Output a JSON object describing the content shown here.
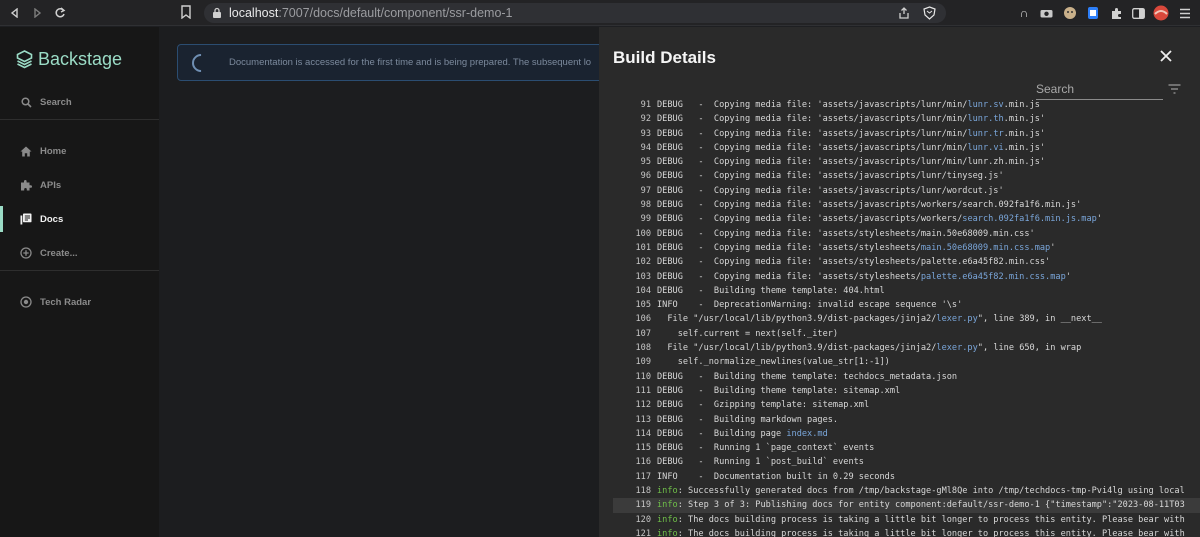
{
  "browser": {
    "url_host": "localhost",
    "url_path": ":7007/docs/default/component/ssr-demo-1"
  },
  "sidebar": {
    "logo": "Backstage",
    "items": [
      {
        "label": "Search",
        "icon": "search-icon"
      },
      {
        "label": "Home",
        "icon": "home-icon"
      },
      {
        "label": "APIs",
        "icon": "puzzle-icon"
      },
      {
        "label": "Docs",
        "icon": "library-icon",
        "active": true
      },
      {
        "label": "Create...",
        "icon": "add-circle-icon"
      },
      {
        "label": "Tech Radar",
        "icon": "radar-icon"
      }
    ],
    "accent": "#9BDCC6"
  },
  "main": {
    "alert": "Documentation is accessed for the first time and is being prepared. The subsequent lo"
  },
  "drawer": {
    "title": "Build Details",
    "search_placeholder": "Search",
    "log": [
      {
        "n": "91",
        "lv": "DEBUG",
        "pre": "   -  Copying media file: 'assets/javascripts/lunr/min/",
        "link": "lunr.sv",
        "post": ".min.js"
      },
      {
        "n": "92",
        "lv": "DEBUG",
        "pre": "   -  Copying media file: 'assets/javascripts/lunr/min/",
        "link": "lunr.th",
        "post": ".min.js'"
      },
      {
        "n": "93",
        "lv": "DEBUG",
        "pre": "   -  Copying media file: 'assets/javascripts/lunr/min/",
        "link": "lunr.tr",
        "post": ".min.js'"
      },
      {
        "n": "94",
        "lv": "DEBUG",
        "pre": "   -  Copying media file: 'assets/javascripts/lunr/min/",
        "link": "lunr.vi",
        "post": ".min.js'"
      },
      {
        "n": "95",
        "lv": "DEBUG",
        "pre": "   -  Copying media file: 'assets/javascripts/lunr/min/lunr.zh.min.js'",
        "link": "",
        "post": ""
      },
      {
        "n": "96",
        "lv": "DEBUG",
        "pre": "   -  Copying media file: 'assets/javascripts/lunr/tinyseg.js'",
        "link": "",
        "post": ""
      },
      {
        "n": "97",
        "lv": "DEBUG",
        "pre": "   -  Copying media file: 'assets/javascripts/lunr/wordcut.js'",
        "link": "",
        "post": ""
      },
      {
        "n": "98",
        "lv": "DEBUG",
        "pre": "   -  Copying media file: 'assets/javascripts/workers/search.092fa1f6.min.js'",
        "link": "",
        "post": ""
      },
      {
        "n": "99",
        "lv": "DEBUG",
        "pre": "   -  Copying media file: 'assets/javascripts/workers/",
        "link": "search.092fa1f6.min.js.map",
        "post": "'"
      },
      {
        "n": "100",
        "lv": "DEBUG",
        "pre": "   -  Copying media file: 'assets/stylesheets/main.50e68009.min.css'",
        "link": "",
        "post": ""
      },
      {
        "n": "101",
        "lv": "DEBUG",
        "pre": "   -  Copying media file: 'assets/stylesheets/",
        "link": "main.50e68009.min.css.map",
        "post": "'"
      },
      {
        "n": "102",
        "lv": "DEBUG",
        "pre": "   -  Copying media file: 'assets/stylesheets/palette.e6a45f82.min.css'",
        "link": "",
        "post": ""
      },
      {
        "n": "103",
        "lv": "DEBUG",
        "pre": "   -  Copying media file: 'assets/stylesheets/",
        "link": "palette.e6a45f82.min.css.map",
        "post": "'"
      },
      {
        "n": "104",
        "lv": "DEBUG",
        "pre": "   -  Building theme template: 404.html",
        "link": "",
        "post": ""
      },
      {
        "n": "105",
        "lv": "INFO",
        "pre": "    -  DeprecationWarning: invalid escape sequence '\\s'",
        "link": "",
        "post": ""
      },
      {
        "n": "106",
        "lv": "",
        "pre": "  File \"/usr/local/lib/python3.9/dist-packages/jinja2/",
        "link": "lexer.py",
        "post": "\", line 389, in __next__"
      },
      {
        "n": "107",
        "lv": "",
        "pre": "    self.current = next(self._iter)",
        "link": "",
        "post": ""
      },
      {
        "n": "108",
        "lv": "",
        "pre": "  File \"/usr/local/lib/python3.9/dist-packages/jinja2/",
        "link": "lexer.py",
        "post": "\", line 650, in wrap"
      },
      {
        "n": "109",
        "lv": "",
        "pre": "    self._normalize_newlines(value_str[1:-1])",
        "link": "",
        "post": ""
      },
      {
        "n": "110",
        "lv": "DEBUG",
        "pre": "   -  Building theme template: techdocs_metadata.json",
        "link": "",
        "post": ""
      },
      {
        "n": "111",
        "lv": "DEBUG",
        "pre": "   -  Building theme template: sitemap.xml",
        "link": "",
        "post": ""
      },
      {
        "n": "112",
        "lv": "DEBUG",
        "pre": "   -  Gzipping template: sitemap.xml",
        "link": "",
        "post": ""
      },
      {
        "n": "113",
        "lv": "DEBUG",
        "pre": "   -  Building markdown pages.",
        "link": "",
        "post": ""
      },
      {
        "n": "114",
        "lv": "DEBUG",
        "pre": "   -  Building page ",
        "link": "index.md",
        "post": ""
      },
      {
        "n": "115",
        "lv": "DEBUG",
        "pre": "   -  Running 1 `page_context` events",
        "link": "",
        "post": ""
      },
      {
        "n": "116",
        "lv": "DEBUG",
        "pre": "   -  Running 1 `post_build` events",
        "link": "",
        "post": ""
      },
      {
        "n": "117",
        "lv": "INFO",
        "pre": "    -  Documentation built in 0.29 seconds",
        "link": "",
        "post": ""
      },
      {
        "n": "118",
        "lv": "info",
        "pre": ": Successfully generated docs from /tmp/backstage-gMl8Qe into /tmp/techdocs-tmp-Pvi4lg using local",
        "link": "",
        "post": ""
      },
      {
        "n": "119",
        "lv": "info",
        "pre": ": Step 3 of 3: Publishing docs for entity component:default/ssr-demo-1 {\"timestamp\":\"2023-08-11T03",
        "link": "",
        "post": "",
        "hl": true
      },
      {
        "n": "120",
        "lv": "info",
        "pre": ": The docs building process is taking a little bit longer to process this entity. Please bear with",
        "link": "",
        "post": ""
      },
      {
        "n": "121",
        "lv": "info",
        "pre": ": The docs building process is taking a little bit longer to process this entity. Please bear with",
        "link": "",
        "post": ""
      }
    ]
  }
}
